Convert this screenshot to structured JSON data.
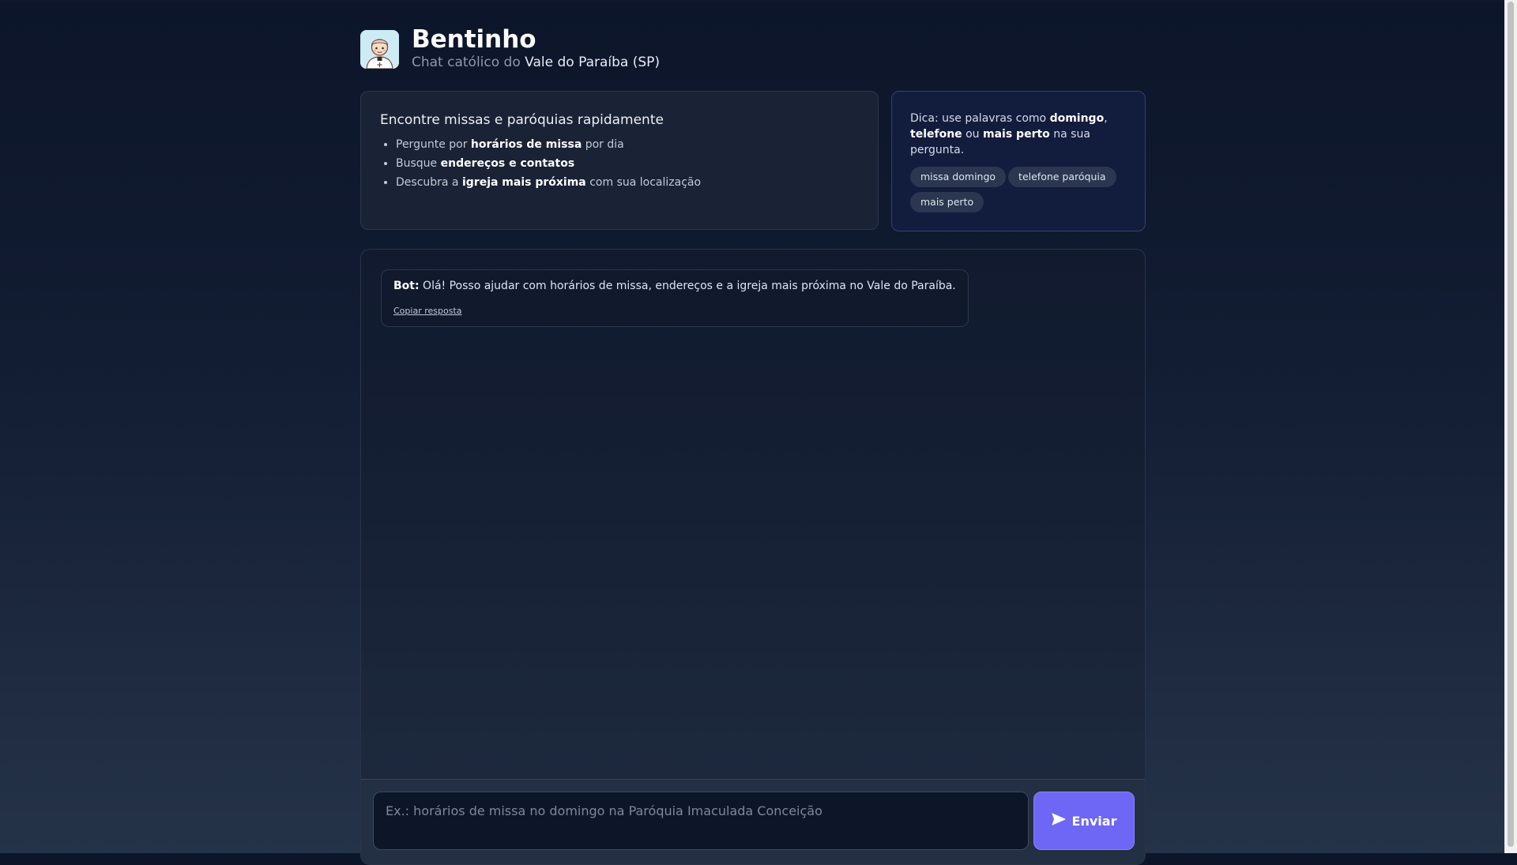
{
  "header": {
    "title": "Bentinho",
    "subtitle_prefix": "Chat católico do",
    "subtitle_region": "Vale do Paraíba (SP)",
    "avatar_icon": "priest-avatar-icon"
  },
  "info_card": {
    "title": "Encontre missas e paróquias rapidamente",
    "items": [
      {
        "pre": "Pergunte por",
        "bold": "horários de missa",
        "post": "por dia"
      },
      {
        "pre": "Busque",
        "bold": "endereços e contatos",
        "post": ""
      },
      {
        "pre": "Descubra a",
        "bold": "igreja mais próxima",
        "post": "com sua localização"
      }
    ]
  },
  "tip_card": {
    "t1": "Dica: use palavras como",
    "b1": "domingo",
    "t2": ",",
    "b2": "telefone",
    "t3": "ou",
    "b3": "mais perto",
    "t4": "na sua pergunta.",
    "chips": [
      "missa domingo",
      "telefone paróquia",
      "mais perto"
    ]
  },
  "chat": {
    "messages": [
      {
        "sender": "Bot:",
        "text": "Olá! Posso ajudar com horários de missa, endereços e a igreja mais próxima no Vale do Paraíba.",
        "copy_label": "Copiar resposta"
      }
    ]
  },
  "composer": {
    "value": "",
    "placeholder": "Ex.: horários de missa no domingo na Paróquia Imaculada Conceição",
    "send_label": "Enviar",
    "send_icon": "send-icon"
  },
  "colors": {
    "accent": "#6e66f4",
    "background_top": "#0c1529",
    "card": "#1a2235",
    "tip_card": "#121c3c"
  }
}
